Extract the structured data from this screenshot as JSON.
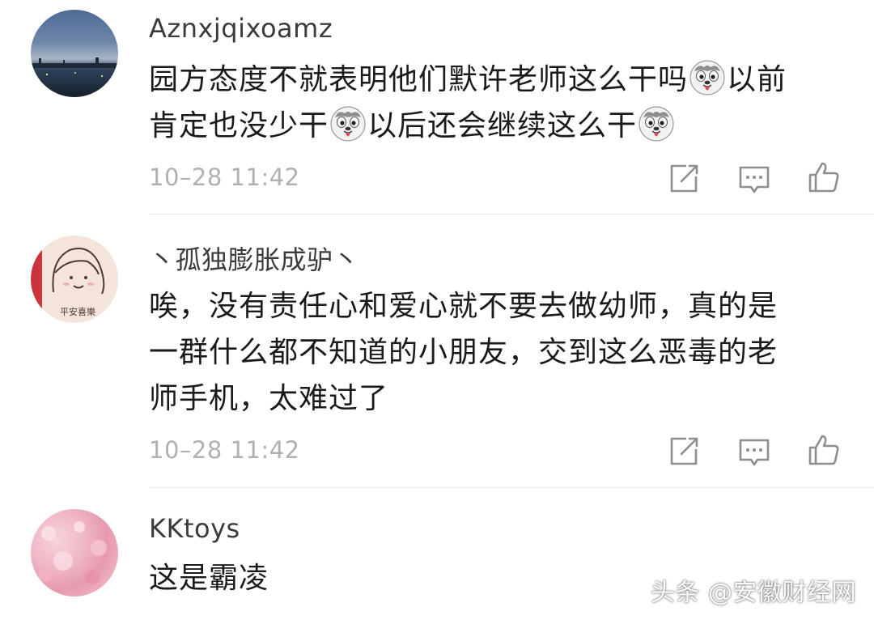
{
  "comments": [
    {
      "username": "Aznxjqixoamz",
      "line1": "园方态度不就表明他们默许老师这么干吗",
      "line1_tail": "以前",
      "line2": "肯定也没少干",
      "line2_tail": "以后还会继续这么干",
      "timestamp": "10–28 11:42"
    },
    {
      "username": "丶孤独膨胀成驴丶",
      "avatar_stamp": "平安喜樂",
      "text": "唉，没有责任心和爱心就不要去做幼师，真的是一群什么都不知道的小朋友，交到这么恶毒的老师手机，太难过了",
      "line1": "唉，没有责任心和爱心就不要去做幼师，真的是",
      "line2": "一群什么都不知道的小朋友，交到这么恶毒的老",
      "line3": "师手机，太难过了",
      "timestamp": "10–28 11:42"
    },
    {
      "username": "KKtoys",
      "text": "这是霸凌"
    }
  ],
  "icons": {
    "share": "share-icon",
    "reply": "comment-icon",
    "like": "thumbs-up-icon",
    "emoji": "husky-dog-emoji"
  },
  "colors": {
    "username": "#3b3b3b",
    "text": "#1a1a1a",
    "timestamp": "#b0b0b0",
    "icon": "#8e8e8e"
  },
  "watermark": "头条 @安徽财经网"
}
